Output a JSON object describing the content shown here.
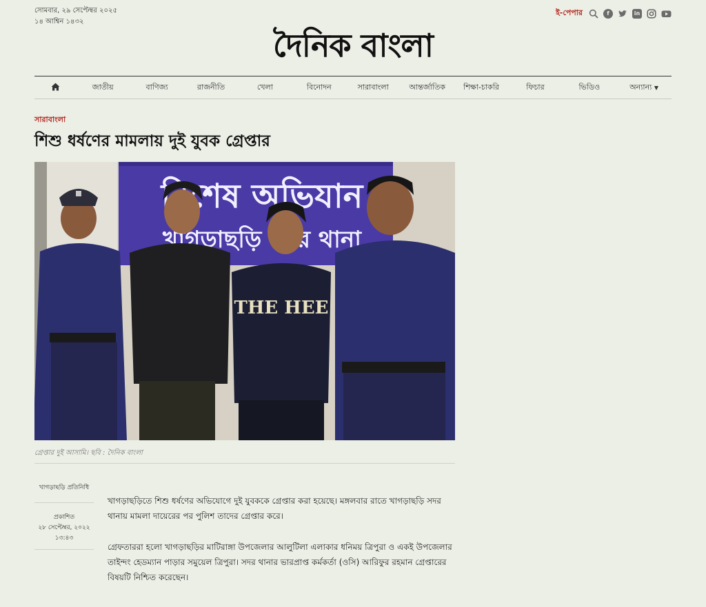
{
  "header": {
    "date_line1": "সোমবার, ২৯ সেপ্টেম্বর ২০২৫",
    "date_line2": "১৪ আশ্বিন ১৪৩২",
    "epaper": "ই-পেপার",
    "logo": "দৈনিক বাংলা",
    "social_icons": [
      "search-icon",
      "facebook-icon",
      "twitter-icon",
      "linkedin-icon",
      "instagram-icon",
      "youtube-icon"
    ]
  },
  "nav": {
    "home_icon": "home-icon",
    "items": [
      "জাতীয়",
      "বাণিজ্য",
      "রাজনীতি",
      "খেলা",
      "বিনোদন",
      "সারাবাংলা",
      "আন্তর্জাতিক",
      "শিক্ষা-চাকরি",
      "ফিচার",
      "ভিডিও"
    ],
    "more": "অন্যান্য"
  },
  "article": {
    "category": "সারাবাংলা",
    "headline": "শিশু ধর্ষণের মামলায় দুই যুবক গ্রেপ্তার",
    "photo_sign_line1": "বিশেষ অভিযান",
    "photo_sign_line2": "খাগড়াছড়ি সদর থানা",
    "photo_shirt_text": "THE HEE",
    "caption": "গ্রেপ্তার দুই আসামি। ছবি : দৈনিক বাংলা",
    "author": "খাগড়াছড়ি প্রতিনিধি",
    "published_label": "প্রকাশিত",
    "published_date": "২৮ সেপ্টেম্বর, ২০২২",
    "published_time": "১৩:৪৩",
    "paragraphs": [
      "খাগড়াছড়িতে শিশু ধর্ষণের অভিযোগে দুই যুবককে গ্রেপ্তার করা হয়েছে। মঙ্গলবার রাতে খাগড়াছড়ি সদর থানায় মামলা দায়েরের পর পুলিশ তাদের গ্রেপ্তার করে।",
      "গ্রেফতাররা হলো খাগড়াছড়ির মাটিরাঙ্গা উপজেলার আলুটিলা এলাকার ধনিময় ত্রিপুরা ও একই উপজেলার তাইন্দং হেডম্যান পাড়ার সমুয়েল ত্রিপুরা। সদর থানার ভারপ্রাপ্ত কর্মকর্তা (ওসি) আরিফুর রহমান গ্রেপ্তারের বিষয়টি নিশ্চিত করেছেন।"
    ]
  }
}
